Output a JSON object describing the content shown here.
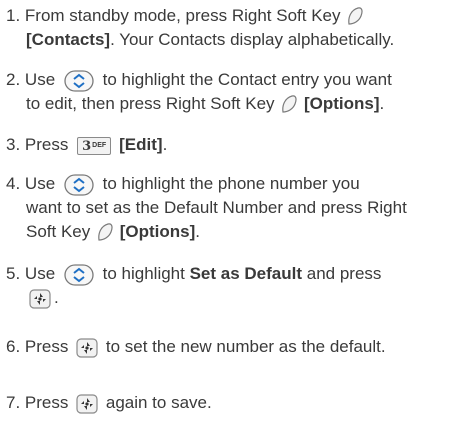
{
  "steps": [
    {
      "num": "1.",
      "a": "From standby mode, press Right Soft Key",
      "b": "[Contacts]",
      "c": ". Your Contacts display alphabetically."
    },
    {
      "num": "2.",
      "a": "Use",
      "b": "to highlight the Contact entry you want",
      "c": "to edit, then press Right Soft Key",
      "d": "[Options]",
      "e": "."
    },
    {
      "num": "3.",
      "a": "Press",
      "key": "3",
      "key_sup": "DEF",
      "b": "[Edit]",
      "c": "."
    },
    {
      "num": "4.",
      "a": "Use",
      "b": "to highlight the phone number you",
      "c": "want to set as the Default Number and press Right",
      "d": "Soft Key",
      "e": "[Options]",
      "f": "."
    },
    {
      "num": "5.",
      "a": "Use",
      "b": "to highlight",
      "c": "Set as Default",
      "d": "and press",
      "e": "."
    },
    {
      "num": "6.",
      "a": "Press",
      "b": "to set the new number as the default."
    },
    {
      "num": "7.",
      "a": "Press",
      "b": "again to save."
    }
  ]
}
